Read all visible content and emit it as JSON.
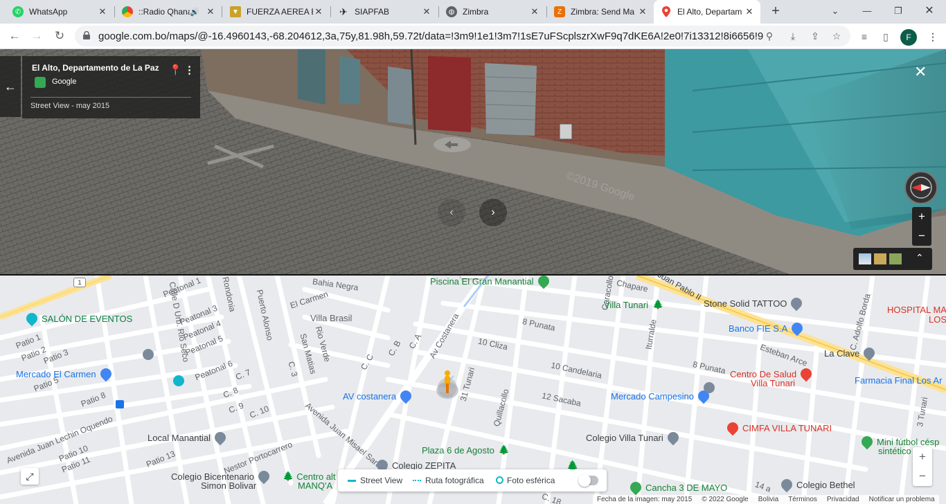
{
  "tabs": [
    {
      "title": "WhatsApp",
      "icon": "whatsapp-icon",
      "color": "#25d366"
    },
    {
      "title": "::Radio Qhana",
      "icon": "radio-icon",
      "color": "#e37400"
    },
    {
      "title": "FUERZA AEREA B",
      "icon": "fab-emblem-icon",
      "color": "#c9a227"
    },
    {
      "title": "SIAPFAB",
      "icon": "airplane-icon",
      "color": "#202124"
    },
    {
      "title": "Zimbra",
      "icon": "globe-icon",
      "color": "#5f6368"
    },
    {
      "title": "Zimbra: Send Ma",
      "icon": "zimbra-icon",
      "color": "#e8710a"
    },
    {
      "title": "El Alto, Departam",
      "icon": "google-maps-icon",
      "color": "#1a73e8",
      "active": true
    }
  ],
  "address": {
    "url": "google.com.bo/maps/@-16.4960143,-68.204612,3a,75y,81.98h,59.72t/data=!3m9!1e1!3m7!1sE7uFScplszrXwF9q7dKE6A!2e0!7i13312!8i6656!9m2!1b1!2i..."
  },
  "profile_initial": "F",
  "streetview": {
    "title": "El Alto, Departamento de La Paz",
    "source": "Google",
    "date": "Street View - may 2015",
    "watermark": "©2019 Google"
  },
  "map": {
    "streets": [
      "Peatonal 1",
      "Peatonal 3",
      "Peatonal 4",
      "Peatonal 5",
      "Peatonal 6",
      "Rondonia",
      "Puerto Alonso",
      "Bahia Negra",
      "El Carmen",
      "Villa Brasil",
      "Rio Verde",
      "San Matias",
      "C. 3",
      "C. 7",
      "C. 8",
      "C. 9",
      "C. 10",
      "C. C",
      "C. B",
      "C. A",
      "Av Costanera",
      "10 Cliza",
      "8 Punata",
      "10 Candelaria",
      "12 Sacaba",
      "31 Tunari",
      "Quillacollo",
      "Iturralde",
      "Chapare",
      "Juan Pablo II",
      "C. Adolfo Borda",
      "Esteban Arce",
      "3 Tunari",
      "Patio 1",
      "Patio 2",
      "Patio 3",
      "Patio 5",
      "Patio 8",
      "Patio 10",
      "Patio 11",
      "Patio 13",
      "Calle D Urb. Rio Seco",
      "Avenida Juan Lechin Oquendo",
      "Avenida Juan Misael Saracho",
      "Nestor Portocarrero",
      "Caracollo",
      "14 a",
      "C. 18",
      "8 Punata"
    ],
    "pois": {
      "piscina": "Piscina El Gran Manantial",
      "villa_tunari": "Villa Tunari",
      "stone_solid": "Stone Solid TATTOO",
      "hospital": "HOSPITAL MA",
      "hospital2": "LOS",
      "salon": "SALÓN DE EVENTOS",
      "banco": "Banco FIE S.A",
      "la_clave": "La Clave",
      "mercado_carmen": "Mercado El Carmen",
      "centro_salud": "Centro De Salud",
      "centro_salud2": "Villa Tunari",
      "farmacia": "Farmacia Final Los Ar",
      "av_costanera": "AV costanera",
      "mercado_campesino": "Mercado Campesino",
      "cimfa": "CIMFA VILLA TUNARI",
      "local_manantial": "Local Manantial",
      "colegio_villa": "Colegio Villa Tunari",
      "mini_futbol": "Mini fútbol césp",
      "mini_futbol2": "sintético",
      "plaza": "Plaza 6 de Agosto",
      "colegio_zepita": "Colegio ZEPITA",
      "colegio_bicentenario": "Colegio Bicentenario",
      "colegio_bicentenario2": "Simon Bolivar",
      "centro_manqa": "Centro alt",
      "centro_manqa2": "MANQ'A",
      "cancha": "Cancha 3 DE MAYO",
      "colegio_bethel": "Colegio Bethel",
      "route_1": "1"
    },
    "layers": {
      "street_view": "Street View",
      "ruta": "Ruta fotográfica",
      "foto": "Foto esférica"
    },
    "footer": [
      "Fecha de la imagen: may 2015",
      "© 2022 Google",
      "Bolivia",
      "Términos",
      "Privacidad",
      "Notificar un problema"
    ]
  }
}
